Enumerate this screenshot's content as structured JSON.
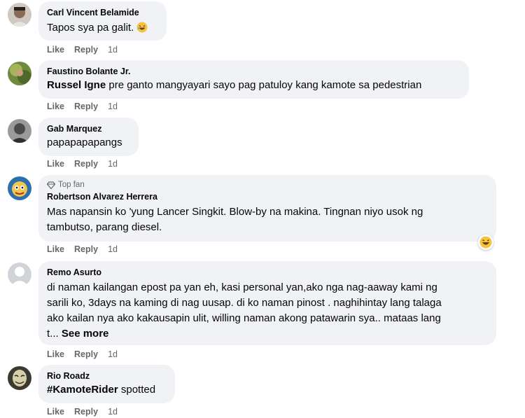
{
  "comments": [
    {
      "author": "Carl Vincent Belamide",
      "text": "Tapos sya pa galit.",
      "actions": {
        "like": "Like",
        "reply": "Reply",
        "time": "1d"
      }
    },
    {
      "author": "Faustino Bolante Jr.",
      "mention": "Russel Igne",
      "text": " pre ganto mangyayari sayo pag patuloy kang kamote sa pedestrian",
      "actions": {
        "like": "Like",
        "reply": "Reply",
        "time": "1d"
      }
    },
    {
      "author": "Gab Marquez",
      "text": "papapapapangs",
      "actions": {
        "like": "Like",
        "reply": "Reply",
        "time": "1d"
      }
    },
    {
      "badge": "Top fan",
      "author": "Robertson Alvarez Herrera",
      "text_line1": "Mas napansin ko 'yung Lancer Singkit. Blow-by na makina. Tingnan niyo usok ng",
      "text_line2": "tambutso, parang diesel.",
      "actions": {
        "like": "Like",
        "reply": "Reply",
        "time": "1d"
      }
    },
    {
      "author": "Remo Asurto",
      "text_line1": "di naman kailangan epost pa yan eh, kasi personal yan,ako nga nag-aaway kami ng",
      "text_line2": "sarili ko, 3days na kaming di nag uusap. di ko naman pinost . naghihintay lang talaga",
      "text_line3": "ako kailan nya ako kakausapin ulit, willing naman akong patawarin sya.. mataas lang",
      "text_line4": "t...",
      "see_more": "See more",
      "actions": {
        "like": "Like",
        "reply": "Reply",
        "time": "1d"
      }
    },
    {
      "author": "Rio Roadz",
      "hashtag": "#KamoteRider",
      "text": " spotted",
      "actions": {
        "like": "Like",
        "reply": "Reply",
        "time": "1d"
      }
    }
  ],
  "colors": {
    "bubble": "#f0f2f5",
    "secondary_text": "#65676b",
    "text": "#050505"
  },
  "icons": [
    "laughing-emoji-icon",
    "diamond-top-fan-icon",
    "default-avatar-icon"
  ]
}
